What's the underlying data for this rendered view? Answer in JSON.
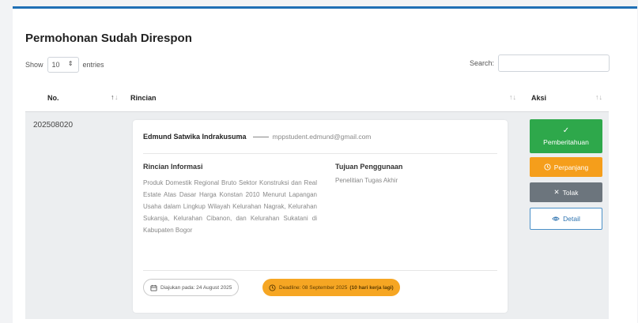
{
  "page": {
    "title": "Permohonan Sudah Direspon"
  },
  "length": {
    "show_label": "Show",
    "selected": "10",
    "entries_label": "entries"
  },
  "search": {
    "label": "Search:",
    "value": ""
  },
  "table": {
    "columns": {
      "no": "No.",
      "rincian": "Rincian",
      "aksi": "Aksi"
    },
    "rows": [
      {
        "no": "202508020",
        "applicant_name": "Edmund Satwika Indrakusuma",
        "applicant_email": "mppstudent.edmund@gmail.com",
        "info_heading": "Rincian Informasi",
        "info_text": "Produk Domestik Regional Bruto Sektor Konstruksi dan Real Estate Atas Dasar Harga Konstan 2010 Menurut Lapangan Usaha dalam Lingkup Wilayah Kelurahan Nagrak, Kelurahan Sukarsja, Kelurahan Cibanon, dan Kelurahan Sukatani di Kabupaten Bogor",
        "purpose_heading": "Tujuan Penggunaan",
        "purpose_text": "Penelitian Tugas Akhir",
        "submitted": "Diajukan pada: 24 August 2025",
        "deadline": "Deadline: 08 September 2025",
        "deadline_note": "(10 hari kerja lagi)"
      }
    ]
  },
  "actions": {
    "notify": "Pemberitahuan",
    "extend": "Perpanjang",
    "reject": "Tolak",
    "detail": "Detail"
  },
  "icons": {
    "check": "check-icon",
    "clock": "clock-icon",
    "close": "close-icon",
    "eye": "eye-icon",
    "calendar": "calendar-icon",
    "sort": "sort-icon"
  },
  "colors": {
    "accent": "#1f6fb5",
    "success": "#2ea84b",
    "warning": "#f59e1b",
    "secondary": "#6c757d",
    "info": "#2f74b0"
  }
}
